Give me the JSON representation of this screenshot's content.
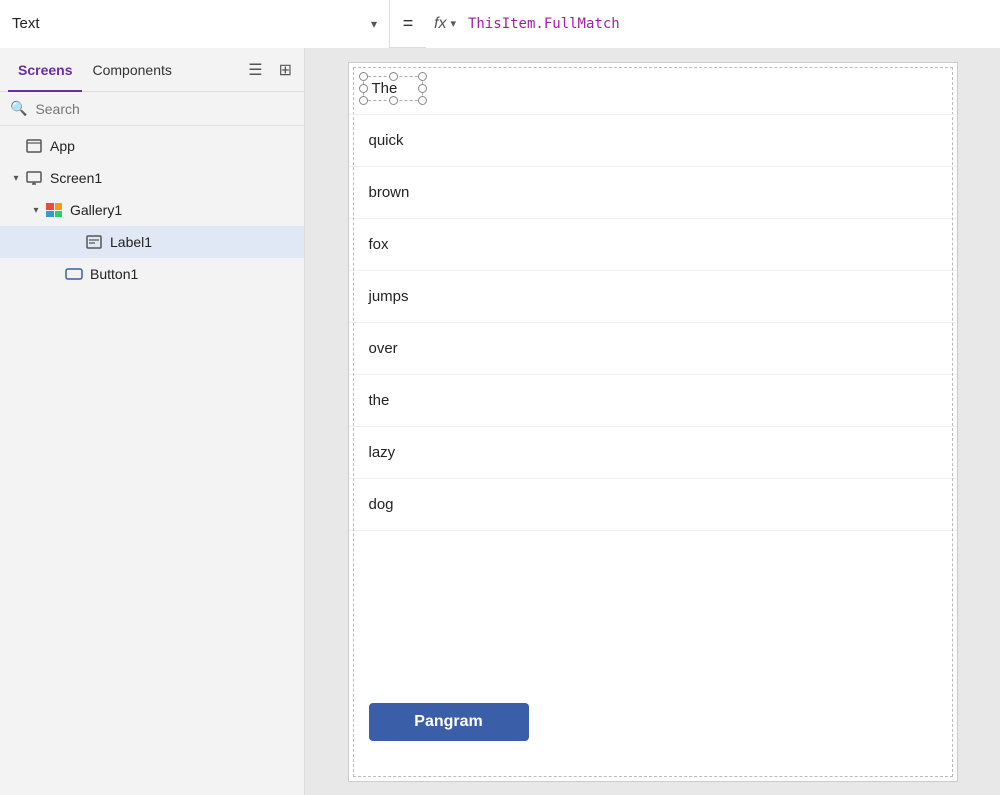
{
  "topbar": {
    "property_label": "Text",
    "equals": "=",
    "fx_label": "fx",
    "formula": "ThisItem.FullMatch"
  },
  "sidebar": {
    "tabs": [
      {
        "id": "screens",
        "label": "Screens",
        "active": true
      },
      {
        "id": "components",
        "label": "Components",
        "active": false
      }
    ],
    "search_placeholder": "Search",
    "tree": [
      {
        "id": "app",
        "label": "App",
        "level": 1,
        "icon": "app",
        "expandable": false
      },
      {
        "id": "screen1",
        "label": "Screen1",
        "level": 1,
        "icon": "screen",
        "expandable": true,
        "expanded": true
      },
      {
        "id": "gallery1",
        "label": "Gallery1",
        "level": 2,
        "icon": "gallery",
        "expandable": true,
        "expanded": true
      },
      {
        "id": "label1",
        "label": "Label1",
        "level": 3,
        "icon": "label",
        "expandable": false,
        "selected": true
      },
      {
        "id": "button1",
        "label": "Button1",
        "level": 2,
        "icon": "button",
        "expandable": false
      }
    ]
  },
  "canvas": {
    "gallery_items": [
      "The",
      "quick",
      "brown",
      "fox",
      "jumps",
      "over",
      "the",
      "lazy",
      "dog"
    ],
    "button_label": "Pangram"
  }
}
